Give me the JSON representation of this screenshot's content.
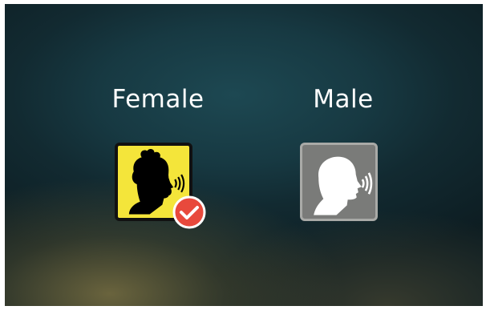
{
  "options": [
    {
      "label": "Female",
      "icon": "female-speaking-head-icon",
      "selected": true
    },
    {
      "label": "Male",
      "icon": "male-speaking-head-icon",
      "selected": false
    }
  ],
  "colors": {
    "female_tile_bg": "#f4e53a",
    "male_tile_bg": "#7a7b79",
    "check_badge": "#e8493c"
  }
}
